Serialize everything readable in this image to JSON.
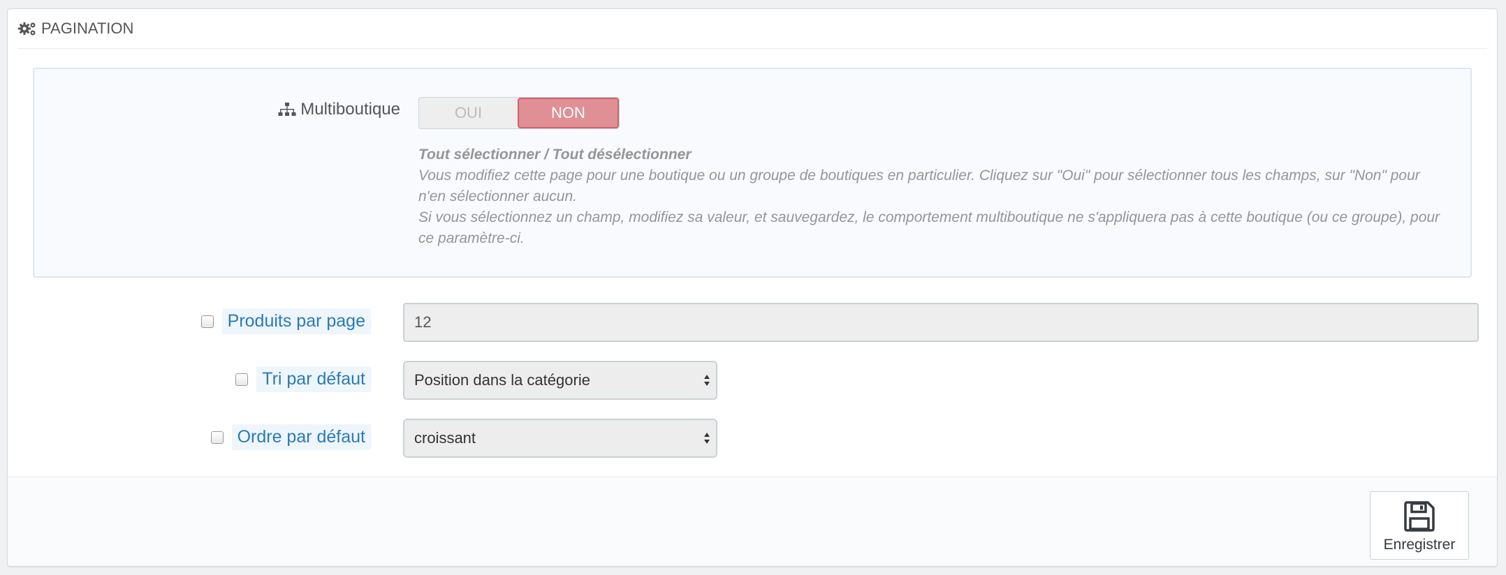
{
  "panel": {
    "title": "PAGINATION"
  },
  "multishop": {
    "label": "Multiboutique",
    "switch": {
      "yes_label": "OUI",
      "no_label": "NON",
      "selected": "NON"
    },
    "help": {
      "title": "Tout sélectionner / Tout désélectionner",
      "line1": "Vous modifiez cette page pour une boutique ou un groupe de boutiques en particulier. Cliquez sur \"Oui\" pour sélectionner tous les champs, sur \"Non\" pour n'en sélectionner aucun.",
      "line2": "Si vous sélectionnez un champ, modifiez sa valeur, et sauvegardez, le comportement multiboutique ne s'appliquera pas à cette boutique (ou ce groupe), pour ce paramètre-ci."
    }
  },
  "fields": {
    "products_per_page": {
      "label": "Produits par page",
      "value": "12"
    },
    "default_sort": {
      "label": "Tri par défaut",
      "value": "Position dans la catégorie"
    },
    "default_order": {
      "label": "Ordre par défaut",
      "value": "croissant"
    }
  },
  "footer": {
    "save_label": "Enregistrer"
  },
  "colors": {
    "accent_blue": "#2a7ab6",
    "switch_active": "#e08f95"
  },
  "icons": {
    "heading": "cogs-icon",
    "multishop": "sitemap-icon",
    "save": "floppy-disk-icon"
  }
}
